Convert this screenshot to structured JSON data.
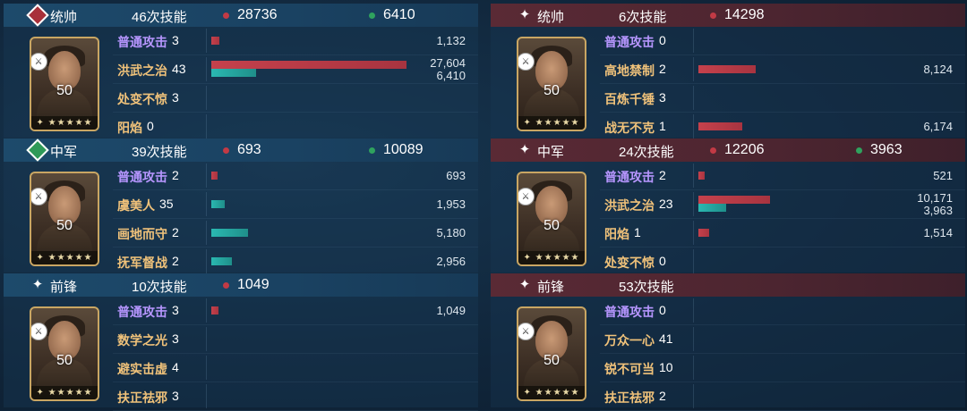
{
  "left": [
    {
      "role": "统帅",
      "role_icon": "sword-diamond-icon",
      "skill_count": "46次技能",
      "damage": "28736",
      "heal": "6410",
      "level": "50",
      "skills": [
        {
          "name": "普通攻击",
          "color": "purple",
          "times": "3",
          "damage": "1,132",
          "heal": "",
          "dmg_frac": 0.04,
          "heal_frac": 0
        },
        {
          "name": "洪武之治",
          "color": "gold",
          "times": "43",
          "damage": "27,604",
          "heal": "6,410",
          "dmg_frac": 1.0,
          "heal_frac": 0.23
        },
        {
          "name": "处变不惊",
          "color": "gold",
          "times": "3",
          "damage": "",
          "heal": "",
          "dmg_frac": 0,
          "heal_frac": 0
        },
        {
          "name": "阳焰",
          "color": "gold",
          "times": "0",
          "damage": "",
          "heal": "",
          "dmg_frac": 0,
          "heal_frac": 0
        }
      ]
    },
    {
      "role": "中军",
      "role_icon": "heart-diamond-icon",
      "skill_count": "39次技能",
      "damage": "693",
      "heal": "10089",
      "level": "50",
      "skills": [
        {
          "name": "普通攻击",
          "color": "purple",
          "times": "2",
          "damage": "693",
          "heal": "",
          "dmg_frac": 0.025,
          "heal_frac": 0
        },
        {
          "name": "虞美人",
          "color": "gold",
          "times": "35",
          "damage": "",
          "heal": "1,953",
          "dmg_frac": 0,
          "heal_frac": 0.071
        },
        {
          "name": "画地而守",
          "color": "gold",
          "times": "2",
          "damage": "",
          "heal": "5,180",
          "dmg_frac": 0,
          "heal_frac": 0.188
        },
        {
          "name": "抚军督战",
          "color": "gold",
          "times": "2",
          "damage": "",
          "heal": "2,956",
          "dmg_frac": 0,
          "heal_frac": 0.107
        }
      ]
    },
    {
      "role": "前锋",
      "role_icon": "sparkle-icon",
      "skill_count": "10次技能",
      "damage": "1049",
      "heal": "",
      "level": "50",
      "skills": [
        {
          "name": "普通攻击",
          "color": "purple",
          "times": "3",
          "damage": "1,049",
          "heal": "",
          "dmg_frac": 0.038,
          "heal_frac": 0
        },
        {
          "name": "数学之光",
          "color": "gold",
          "times": "3",
          "damage": "",
          "heal": "",
          "dmg_frac": 0,
          "heal_frac": 0
        },
        {
          "name": "避实击虚",
          "color": "gold",
          "times": "4",
          "damage": "",
          "heal": "",
          "dmg_frac": 0,
          "heal_frac": 0
        },
        {
          "name": "扶正祛邪",
          "color": "gold",
          "times": "3",
          "damage": "",
          "heal": "",
          "dmg_frac": 0,
          "heal_frac": 0
        }
      ]
    }
  ],
  "right": [
    {
      "role": "统帅",
      "role_icon": "sparkle-icon",
      "skill_count": "6次技能",
      "damage": "14298",
      "heal": "",
      "level": "50",
      "skills": [
        {
          "name": "普通攻击",
          "color": "purple",
          "times": "0",
          "damage": "",
          "heal": "",
          "dmg_frac": 0,
          "heal_frac": 0
        },
        {
          "name": "高地禁制",
          "color": "gold",
          "times": "2",
          "damage": "8,124",
          "heal": "",
          "dmg_frac": 0.294,
          "heal_frac": 0
        },
        {
          "name": "百炼千锤",
          "color": "gold",
          "times": "3",
          "damage": "",
          "heal": "",
          "dmg_frac": 0,
          "heal_frac": 0
        },
        {
          "name": "战无不克",
          "color": "gold",
          "times": "1",
          "damage": "6,174",
          "heal": "",
          "dmg_frac": 0.224,
          "heal_frac": 0
        }
      ]
    },
    {
      "role": "中军",
      "role_icon": "sparkle-icon",
      "skill_count": "24次技能",
      "damage": "12206",
      "heal": "3963",
      "level": "50",
      "skills": [
        {
          "name": "普通攻击",
          "color": "purple",
          "times": "2",
          "damage": "521",
          "heal": "",
          "dmg_frac": 0.019,
          "heal_frac": 0
        },
        {
          "name": "洪武之治",
          "color": "gold",
          "times": "23",
          "damage": "10,171",
          "heal": "3,963",
          "dmg_frac": 0.368,
          "heal_frac": 0.144
        },
        {
          "name": "阳焰",
          "color": "gold",
          "times": "1",
          "damage": "1,514",
          "heal": "",
          "dmg_frac": 0.055,
          "heal_frac": 0
        },
        {
          "name": "处变不惊",
          "color": "gold",
          "times": "0",
          "damage": "",
          "heal": "",
          "dmg_frac": 0,
          "heal_frac": 0
        }
      ]
    },
    {
      "role": "前锋",
      "role_icon": "sparkle-icon",
      "skill_count": "53次技能",
      "damage": "",
      "heal": "",
      "level": "50",
      "skills": [
        {
          "name": "普通攻击",
          "color": "purple",
          "times": "0",
          "damage": "",
          "heal": "",
          "dmg_frac": 0,
          "heal_frac": 0
        },
        {
          "name": "万众一心",
          "color": "gold",
          "times": "41",
          "damage": "",
          "heal": "",
          "dmg_frac": 0,
          "heal_frac": 0
        },
        {
          "name": "锐不可当",
          "color": "gold",
          "times": "10",
          "damage": "",
          "heal": "",
          "dmg_frac": 0,
          "heal_frac": 0
        },
        {
          "name": "扶正祛邪",
          "color": "gold",
          "times": "2",
          "damage": "",
          "heal": "",
          "dmg_frac": 0,
          "heal_frac": 0
        }
      ]
    }
  ]
}
